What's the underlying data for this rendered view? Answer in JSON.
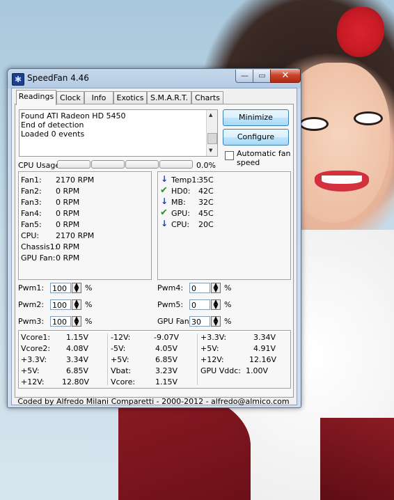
{
  "window": {
    "title": "SpeedFan 4.46",
    "icon": "fan-icon",
    "caption_minimize": "—",
    "caption_maximize": "▭",
    "caption_close": "✕"
  },
  "tabs": [
    {
      "label": "Readings",
      "active": true
    },
    {
      "label": "Clock"
    },
    {
      "label": "Info"
    },
    {
      "label": "Exotics"
    },
    {
      "label": "S.M.A.R.T."
    },
    {
      "label": "Charts"
    }
  ],
  "log": [
    "Found ATI Radeon HD 5450",
    "End of detection",
    "Loaded 0 events"
  ],
  "buttons": {
    "minimize": "Minimize",
    "configure": "Configure"
  },
  "auto_fan": {
    "label_line1": "Automatic fan",
    "label_line2": "speed",
    "checked": false
  },
  "cpu": {
    "label": "CPU Usage",
    "value": "0.0%"
  },
  "fans": [
    {
      "label": "Fan1:",
      "value": "2170 RPM"
    },
    {
      "label": "Fan2:",
      "value": "0 RPM"
    },
    {
      "label": "Fan3:",
      "value": "0 RPM"
    },
    {
      "label": "Fan4:",
      "value": "0 RPM"
    },
    {
      "label": "Fan5:",
      "value": "0 RPM"
    },
    {
      "label": "CPU:",
      "value": "2170 RPM"
    },
    {
      "label": "Chassis1:",
      "value": "0 RPM"
    },
    {
      "label": "GPU Fan:",
      "value": "0 RPM"
    }
  ],
  "temps": [
    {
      "icon": "arrow-down-icon",
      "label": "Temp1:",
      "value": "35C"
    },
    {
      "icon": "checkmark-icon",
      "label": "HD0:",
      "value": "42C"
    },
    {
      "icon": "arrow-down-icon",
      "label": "MB:",
      "value": "32C"
    },
    {
      "icon": "checkmark-icon",
      "label": "GPU:",
      "value": "45C"
    },
    {
      "icon": "arrow-down-icon",
      "label": "CPU:",
      "value": "20C"
    }
  ],
  "pwm": [
    {
      "label": "Pwm1:",
      "value": "100"
    },
    {
      "label": "Pwm2:",
      "value": "100"
    },
    {
      "label": "Pwm3:",
      "value": "100"
    },
    {
      "label": "Pwm4:",
      "value": "0"
    },
    {
      "label": "Pwm5:",
      "value": "0"
    },
    {
      "label": "GPU Fan:",
      "value": "30"
    }
  ],
  "pwm_unit": "%",
  "voltages": [
    [
      {
        "label": "Vcore1:",
        "value": "1.15V"
      },
      {
        "label": "Vcore2:",
        "value": "4.08V"
      },
      {
        "label": "+3.3V:",
        "value": "3.34V"
      },
      {
        "label": "+5V:",
        "value": "6.85V"
      },
      {
        "label": "+12V:",
        "value": "12.80V"
      }
    ],
    [
      {
        "label": "-12V:",
        "value": "-9.07V"
      },
      {
        "label": "-5V:",
        "value": "4.05V"
      },
      {
        "label": "+5V:",
        "value": "6.85V"
      },
      {
        "label": "Vbat:",
        "value": "3.23V"
      },
      {
        "label": "Vcore:",
        "value": "1.15V"
      }
    ],
    [
      {
        "label": "+3.3V:",
        "value": "3.34V"
      },
      {
        "label": "+5V:",
        "value": "4.91V"
      },
      {
        "label": "+12V:",
        "value": "12.16V"
      },
      {
        "label": "GPU Vddc:",
        "value": "1.00V"
      }
    ]
  ],
  "status": "Coded by Alfredo Milani Comparetti - 2000-2012 - alfredo@almico.com"
}
